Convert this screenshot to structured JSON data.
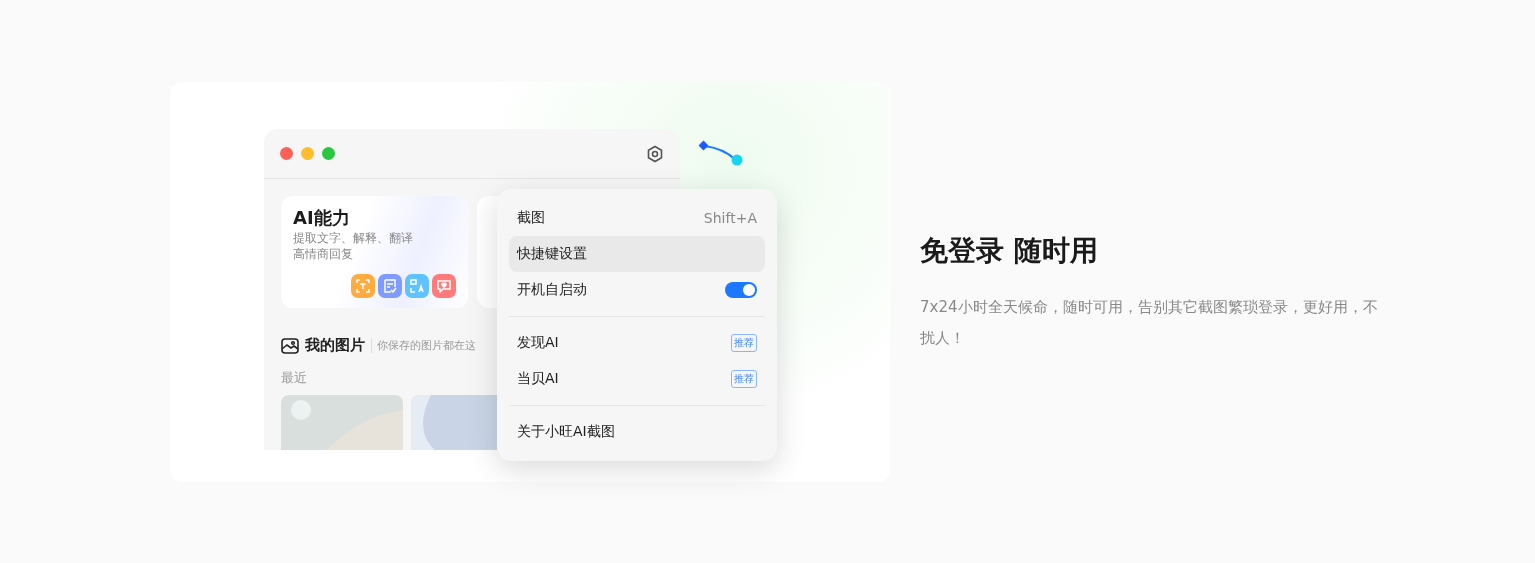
{
  "app_window": {
    "feature_cards": [
      {
        "kind": "full",
        "title": "AI能力",
        "lines": [
          "提取文字、解释、翻译",
          "高情商回复"
        ],
        "tools": [
          {
            "kind": "text-scan",
            "color": "#ffab40"
          },
          {
            "kind": "note",
            "color": "#7f9bff"
          },
          {
            "kind": "translate",
            "color": "#5ec3ff"
          },
          {
            "kind": "chat",
            "color": "#ff7a7a"
          }
        ]
      },
      {
        "kind": "covered"
      }
    ],
    "section": {
      "title": "我的图片",
      "subtitle": "你保存的图片都在这"
    },
    "recent_label": "最近"
  },
  "menu": {
    "items": [
      {
        "kind": "shortcut",
        "label": "截图",
        "shortcut": "Shift+A",
        "selected": false
      },
      {
        "kind": "action",
        "label": "快捷键设置",
        "selected": true
      },
      {
        "kind": "toggle",
        "label": "开机自启动",
        "on": true,
        "selected": false
      },
      {
        "kind": "divider"
      },
      {
        "kind": "badge",
        "label": "发现AI",
        "badge": "推荐",
        "selected": false
      },
      {
        "kind": "badge",
        "label": "当贝AI",
        "badge": "推荐",
        "selected": false
      },
      {
        "kind": "divider"
      },
      {
        "kind": "action",
        "label": "关于小旺AI截图",
        "selected": false
      }
    ]
  },
  "feature": {
    "title": "免登录 随时用",
    "description": "7x24小时全天候命，随时可用，告别其它截图繁琐登录，更好用，不扰人！"
  }
}
